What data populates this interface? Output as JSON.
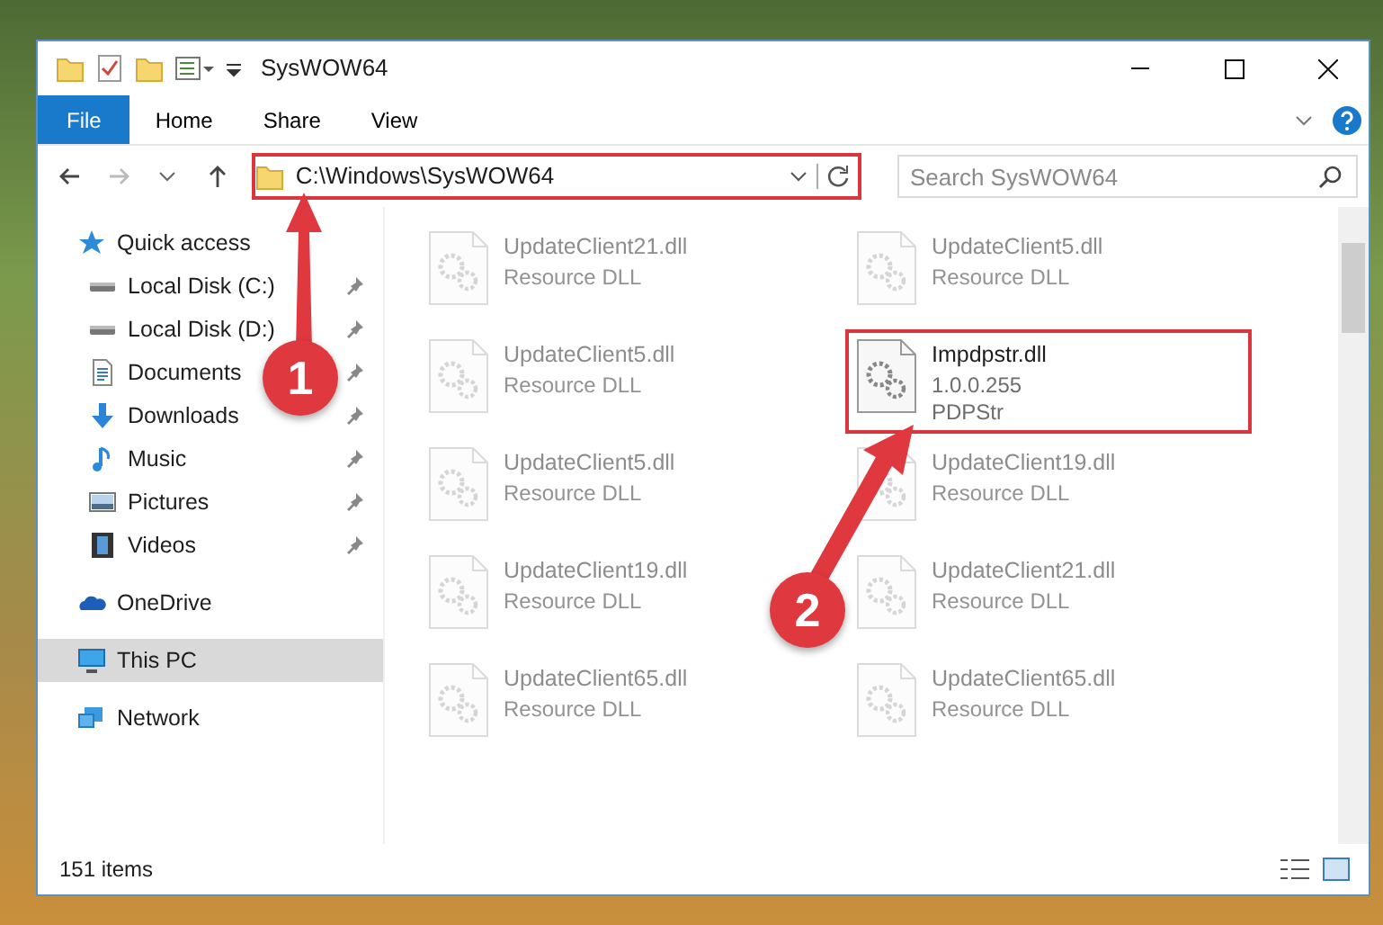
{
  "window": {
    "title": "SysWOW64"
  },
  "ribbon_tabs": [
    {
      "label": "File",
      "kind": "file",
      "selected": false
    },
    {
      "label": "Home",
      "kind": "tab",
      "selected": false
    },
    {
      "label": "Share",
      "kind": "tab",
      "selected": false
    },
    {
      "label": "View",
      "kind": "tab",
      "selected": false
    }
  ],
  "address": {
    "path": "C:\\Windows\\SysWOW64",
    "highlighted": true
  },
  "search": {
    "placeholder": "Search SysWOW64"
  },
  "sidebar": [
    {
      "label": "Quick access",
      "kind": "star",
      "selected": false,
      "children": [
        {
          "label": "Local Disk (C:)",
          "kind": "drive",
          "pinned": true,
          "selected": false
        },
        {
          "label": "Local Disk (D:)",
          "kind": "drive",
          "pinned": true,
          "selected": false
        },
        {
          "label": "Documents",
          "kind": "document",
          "pinned": true,
          "selected": false
        },
        {
          "label": "Downloads",
          "kind": "download",
          "pinned": true,
          "selected": false
        },
        {
          "label": "Music",
          "kind": "music",
          "pinned": true,
          "selected": false
        },
        {
          "label": "Pictures",
          "kind": "picture",
          "pinned": true,
          "selected": false
        },
        {
          "label": "Videos",
          "kind": "video",
          "pinned": true,
          "selected": false
        }
      ]
    },
    {
      "label": "OneDrive",
      "kind": "cloud",
      "selected": false
    },
    {
      "label": "This PC",
      "kind": "computer",
      "selected": true
    },
    {
      "label": "Network",
      "kind": "network",
      "selected": false
    }
  ],
  "files": [
    {
      "name": "UpdateClient21.dll",
      "lines": [
        "Resource DLL"
      ],
      "faded": true,
      "highlighted": false
    },
    {
      "name": "UpdateClient5.dll",
      "lines": [
        "Resource DLL"
      ],
      "faded": true,
      "highlighted": false
    },
    {
      "name": "UpdateClient5.dll",
      "lines": [
        "Resource DLL"
      ],
      "faded": true,
      "highlighted": false
    },
    {
      "name": "Impdpstr.dll",
      "lines": [
        "1.0.0.255",
        "PDPStr"
      ],
      "faded": false,
      "highlighted": true
    },
    {
      "name": "UpdateClient5.dll",
      "lines": [
        "Resource DLL"
      ],
      "faded": true,
      "highlighted": false
    },
    {
      "name": "UpdateClient19.dll",
      "lines": [
        "Resource DLL"
      ],
      "faded": true,
      "highlighted": false
    },
    {
      "name": "UpdateClient19.dll",
      "lines": [
        "Resource DLL"
      ],
      "faded": true,
      "highlighted": false
    },
    {
      "name": "UpdateClient21.dll",
      "lines": [
        "Resource DLL"
      ],
      "faded": true,
      "highlighted": false
    },
    {
      "name": "UpdateClient65.dll",
      "lines": [
        "Resource DLL"
      ],
      "faded": true,
      "highlighted": false
    },
    {
      "name": "UpdateClient65.dll",
      "lines": [
        "Resource DLL"
      ],
      "faded": true,
      "highlighted": false
    }
  ],
  "status_bar": {
    "item_count": "151 items"
  },
  "annotations": [
    {
      "number": "1"
    },
    {
      "number": "2"
    }
  ]
}
